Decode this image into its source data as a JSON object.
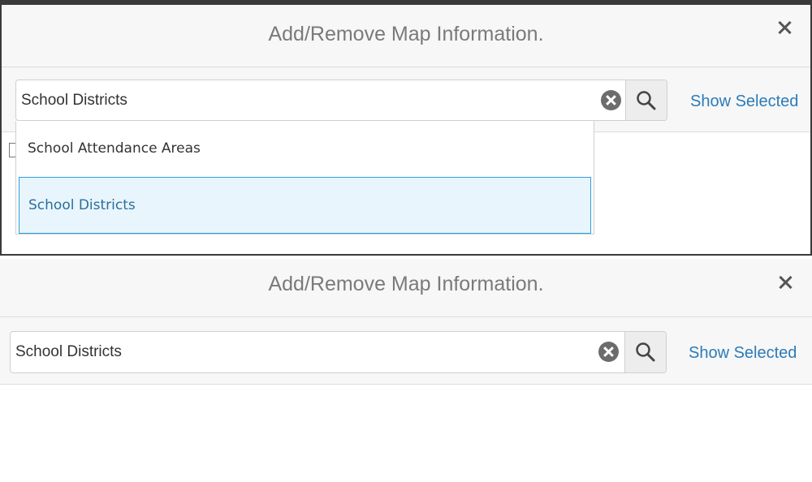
{
  "panels": [
    {
      "title": "Add/Remove Map Information.",
      "search_value": "School Districts",
      "show_selected_label": "Show Selected",
      "dropdown_items": [
        "School Attendance Areas",
        "School Districts"
      ],
      "highlighted_item": "School Districts"
    },
    {
      "title": "Add/Remove Map Information.",
      "search_value": "School Districts",
      "show_selected_label": "Show Selected"
    }
  ],
  "icons": {
    "close": "close-icon",
    "clear": "clear-icon",
    "search": "search-icon"
  },
  "colors": {
    "link": "#2b7bb9",
    "highlight_bg": "#e8f5fd",
    "highlight_border": "#2aa0dc"
  }
}
